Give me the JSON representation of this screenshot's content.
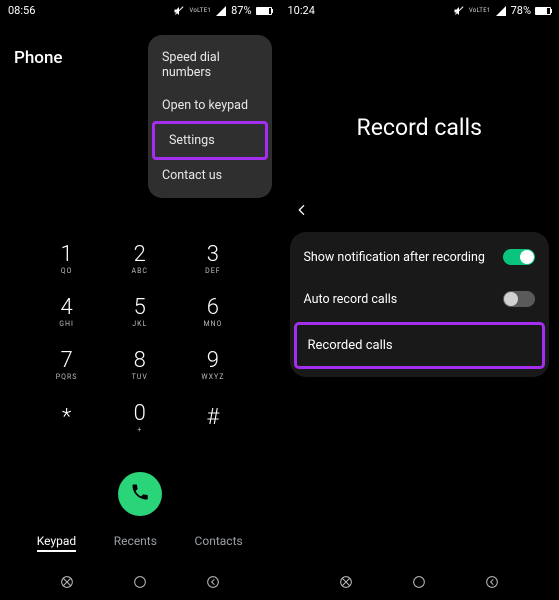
{
  "left": {
    "status": {
      "time": "08:56",
      "battery_pct": "87%",
      "vo_label": "VoLTE1"
    },
    "app_title": "Phone",
    "menu": {
      "items": [
        {
          "label": "Speed dial numbers"
        },
        {
          "label": "Open to keypad"
        },
        {
          "label": "Settings",
          "highlighted": true
        },
        {
          "label": "Contact us"
        }
      ]
    },
    "keys": [
      {
        "digit": "1",
        "letters": "QO"
      },
      {
        "digit": "2",
        "letters": "ABC"
      },
      {
        "digit": "3",
        "letters": "DEF"
      },
      {
        "digit": "4",
        "letters": "GHI"
      },
      {
        "digit": "5",
        "letters": "JKL"
      },
      {
        "digit": "6",
        "letters": "MNO"
      },
      {
        "digit": "7",
        "letters": "PQRS"
      },
      {
        "digit": "8",
        "letters": "TUV"
      },
      {
        "digit": "9",
        "letters": "WXYZ"
      },
      {
        "digit": "*",
        "letters": ""
      },
      {
        "digit": "0",
        "letters": "+"
      },
      {
        "digit": "#",
        "letters": ""
      }
    ],
    "tabs": {
      "keypad": "Keypad",
      "recents": "Recents",
      "contacts": "Contacts"
    }
  },
  "right": {
    "status": {
      "time": "10:24",
      "battery_pct": "78%",
      "vo_label": "VoLTE1"
    },
    "title": "Record calls",
    "settings": {
      "show_notification": {
        "label": "Show notification after recording",
        "on": true
      },
      "auto_record": {
        "label": "Auto record calls",
        "on": false
      },
      "recorded_calls": {
        "label": "Recorded calls",
        "highlighted": true
      }
    }
  }
}
